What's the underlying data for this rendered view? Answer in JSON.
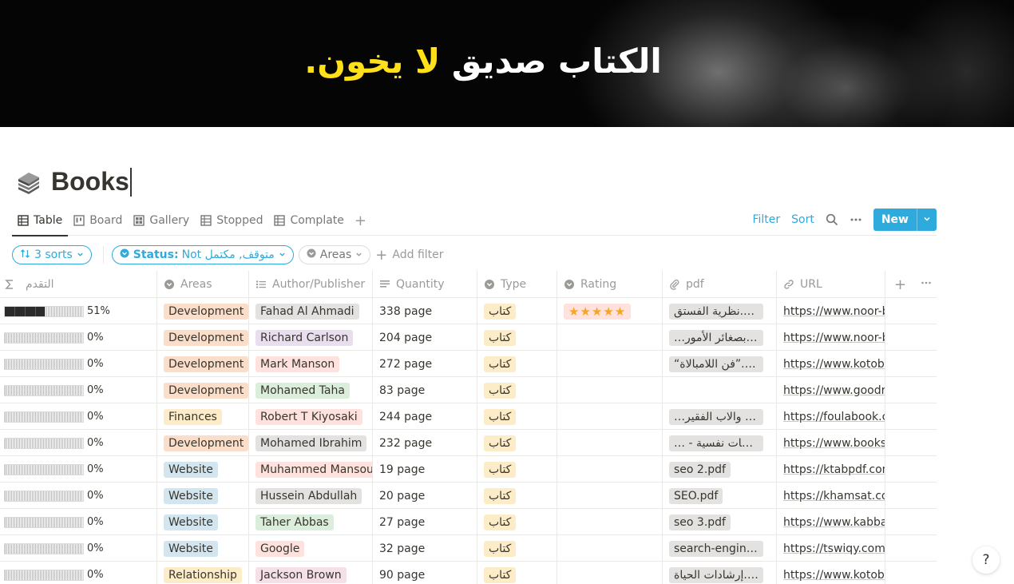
{
  "banner": {
    "text_before": "الكتاب صديق ",
    "text_highlight": "لا",
    "text_after": " يخون."
  },
  "page": {
    "title": "Books"
  },
  "views": {
    "tabs": [
      {
        "label": "Table",
        "icon": "table-icon",
        "active": true
      },
      {
        "label": "Board",
        "icon": "board-icon",
        "active": false
      },
      {
        "label": "Gallery",
        "icon": "gallery-icon",
        "active": false
      },
      {
        "label": "Stopped",
        "icon": "table-icon",
        "active": false
      },
      {
        "label": "Complate",
        "icon": "table-icon",
        "active": false
      }
    ],
    "add": "+",
    "filter_label": "Filter",
    "sort_label": "Sort",
    "new_label": "New"
  },
  "filters": {
    "sorts": "3 sorts",
    "status_key": "Status:",
    "status_value": "Not متوقف, مكتمل",
    "areas": "Areas",
    "add_filter": "Add filter"
  },
  "columns": {
    "progress": "التقدم",
    "areas": "Areas",
    "author": "Author/Publisher",
    "quantity": "Quantity",
    "type": "Type",
    "rating": "Rating",
    "pdf": "pdf",
    "url": "URL"
  },
  "rows": [
    {
      "progress": 51,
      "pct": "51%",
      "area": "Development",
      "area_color": "orange",
      "author": "Fahad Al Ahmadi",
      "author_color": "gray",
      "qty": "338 page",
      "type": "كتاب",
      "rating": "★★★★★",
      "pdf": "نظرية الفستق.pdf",
      "url": "https://www.noor-book.com"
    },
    {
      "progress": 0,
      "pct": "0%",
      "area": "Development",
      "area_color": "orange",
      "author": "Richard Carlson",
      "author_color": "purple",
      "qty": "204 page",
      "type": "كتاب",
      "rating": "",
      "pdf": "…تم بصغائر الأمور",
      "url": "https://www.noor-book.com"
    },
    {
      "progress": 0,
      "pct": "0%",
      "area": "Development",
      "area_color": "orange",
      "author": "Mark Manson",
      "author_color": "red",
      "qty": "272 page",
      "type": "كتاب",
      "rating": "",
      "pdf": "“فن اللامبالاة”.pdf",
      "url": "https://www.kotobati.com"
    },
    {
      "progress": 0,
      "pct": "0%",
      "area": "Development",
      "area_color": "orange",
      "author": "Mohamed Taha",
      "author_color": "green",
      "qty": "83 page",
      "type": "كتاب",
      "rating": "",
      "pdf": "",
      "url": "https://www.goodreads.com"
    },
    {
      "progress": 0,
      "pct": "0%",
      "area": "Finances",
      "area_color": "yellow",
      "author": "Robert T Kiyosaki",
      "author_color": "red",
      "qty": "244 page",
      "type": "كتاب",
      "rating": "",
      "pdf": "…غني والاب الفقير",
      "url": "https://foulabook.com"
    },
    {
      "progress": 0,
      "pct": "0%",
      "area": "Development",
      "area_color": "orange",
      "author": "Mohamed Ibrahim",
      "author_color": "gray",
      "qty": "232 page",
      "type": "كتاب",
      "rating": "",
      "pdf": "… - جلسات نفسية",
      "url": "https://www.books-library.net"
    },
    {
      "progress": 0,
      "pct": "0%",
      "area": "Website",
      "area_color": "blue",
      "author": "Muhammed Mansour",
      "author_color": "red",
      "qty": "19 page",
      "type": "كتاب",
      "rating": "",
      "pdf": "seo 2.pdf",
      "url": "https://ktabpdf.com/"
    },
    {
      "progress": 0,
      "pct": "0%",
      "area": "Website",
      "area_color": "blue",
      "author": "Hussein Abdullah",
      "author_color": "gray",
      "qty": "20 page",
      "type": "كتاب",
      "rating": "",
      "pdf": "SEO.pdf",
      "url": "https://khamsat.com"
    },
    {
      "progress": 0,
      "pct": "0%",
      "area": "Website",
      "area_color": "blue",
      "author": "Taher Abbas",
      "author_color": "green",
      "qty": "27 page",
      "type": "كتاب",
      "rating": "",
      "pdf": "seo 3.pdf",
      "url": "https://www.kabbani.com"
    },
    {
      "progress": 0,
      "pct": "0%",
      "area": "Website",
      "area_color": "blue",
      "author": "Google",
      "author_color": "red",
      "qty": "32 page",
      "type": "كتاب",
      "rating": "",
      "pdf": "search-engine....",
      "url": "https://tswiqy.com/و"
    },
    {
      "progress": 0,
      "pct": "0%",
      "area": "Relationship",
      "area_color": "yellow",
      "author": "Jackson Brown",
      "author_color": "pink",
      "qty": "90 page",
      "type": "كتاب",
      "rating": "",
      "pdf": "إرشادات الحياة.pdf",
      "url": "https://www.kotobati.com"
    }
  ],
  "help": "?"
}
